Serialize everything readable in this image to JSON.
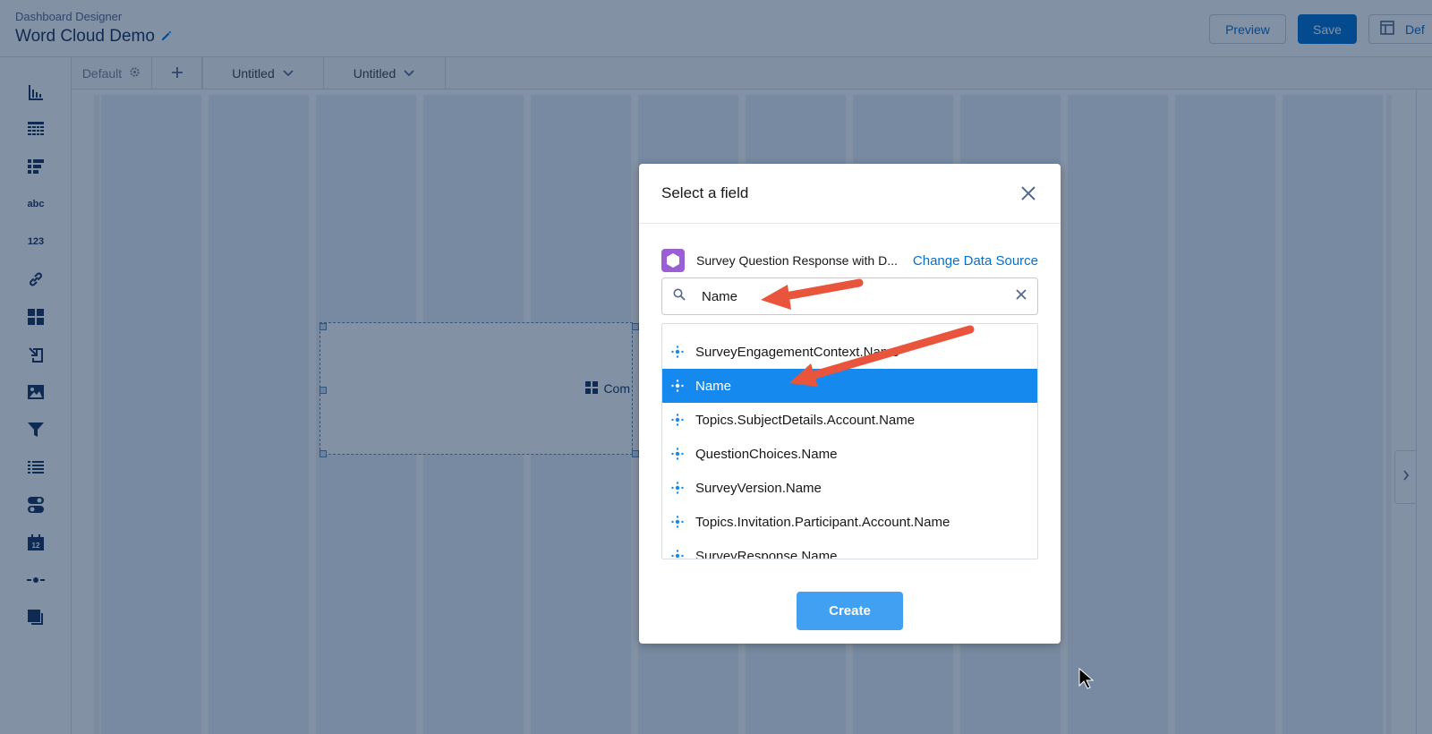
{
  "header": {
    "app_name": "Dashboard Designer",
    "title": "Word Cloud Demo",
    "preview_label": "Preview",
    "save_label": "Save",
    "layout_label": "Def"
  },
  "sidebar": {
    "tools": [
      {
        "icon": "bar-chart-icon"
      },
      {
        "icon": "table-icon"
      },
      {
        "icon": "compare-table-icon"
      },
      {
        "icon": "text-icon",
        "text": "abc"
      },
      {
        "icon": "number-icon",
        "text": "123"
      },
      {
        "icon": "link-icon"
      },
      {
        "icon": "container-icon"
      },
      {
        "icon": "import-icon"
      },
      {
        "icon": "image-icon"
      },
      {
        "icon": "filter-icon"
      },
      {
        "icon": "list-icon"
      },
      {
        "icon": "toggle-icon"
      },
      {
        "icon": "calendar-icon",
        "text": "12"
      },
      {
        "icon": "range-icon"
      },
      {
        "icon": "layers-icon"
      }
    ]
  },
  "tabs": {
    "default_label": "Default",
    "add_label": "+",
    "items": [
      {
        "label": "Untitled"
      },
      {
        "label": "Untitled"
      }
    ]
  },
  "canvas": {
    "widget_label": "Com"
  },
  "modal": {
    "title": "Select a field",
    "datasource_name": "Survey Question Response with D...",
    "change_datasource_label": "Change Data Source",
    "search_value": "Name",
    "fields": [
      {
        "label": "SurveyEngagementContext.Name",
        "selected": false
      },
      {
        "label": "Name",
        "selected": true
      },
      {
        "label": "Topics.SubjectDetails.Account.Name",
        "selected": false
      },
      {
        "label": "QuestionChoices.Name",
        "selected": false
      },
      {
        "label": "SurveyVersion.Name",
        "selected": false
      },
      {
        "label": "Topics.Invitation.Participant.Account.Name",
        "selected": false
      },
      {
        "label": "SurveyResponse.Name",
        "selected": false
      }
    ],
    "create_label": "Create"
  },
  "colors": {
    "brand_blue": "#0070d2",
    "selected_row": "#1589ee",
    "create_button": "#41a0f2",
    "datasource_icon": "#9a5fd4",
    "annotation_arrow": "#e8553c"
  }
}
